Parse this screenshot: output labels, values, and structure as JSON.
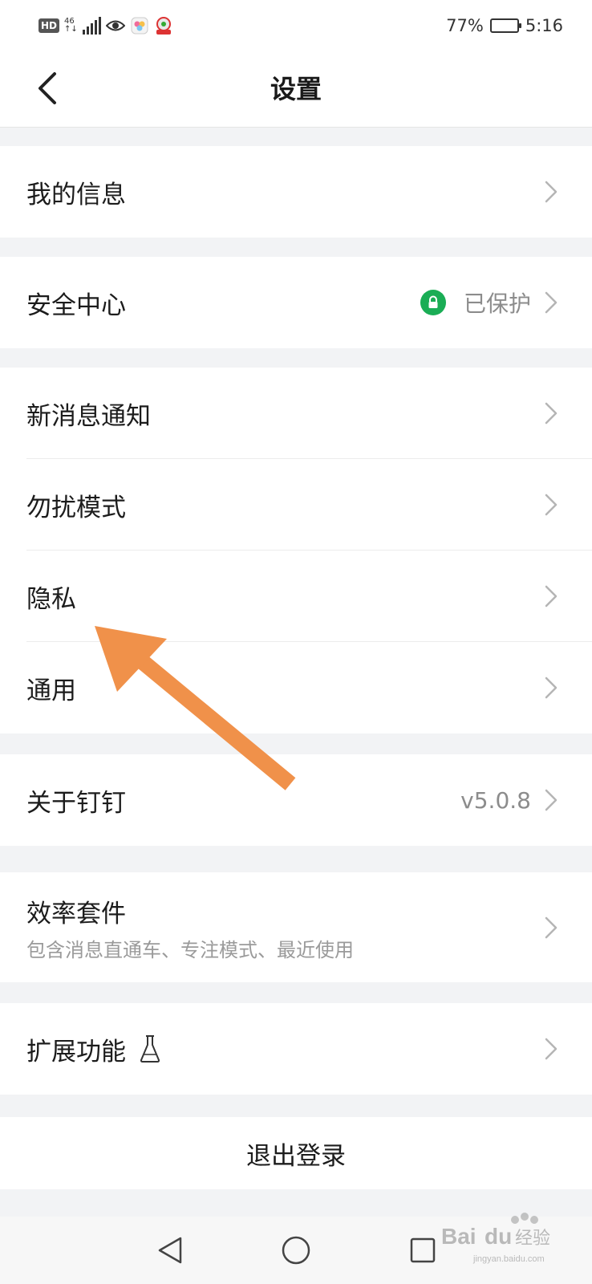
{
  "status_bar": {
    "hd": "HD",
    "network_top": "46",
    "network_bottom": "↑↓",
    "battery_percent": "77%",
    "battery_level": 0.77,
    "time": "5:16"
  },
  "header": {
    "title": "设置",
    "back_icon": "chevron-left-icon"
  },
  "sections": [
    {
      "items": [
        {
          "label": "我的信息"
        }
      ]
    },
    {
      "items": [
        {
          "label": "安全中心",
          "value": "已保护",
          "badge_icon": "lock-icon",
          "badge_color": "#1aad55"
        }
      ]
    },
    {
      "items": [
        {
          "label": "新消息通知"
        },
        {
          "label": "勿扰模式"
        },
        {
          "label": "隐私"
        },
        {
          "label": "通用"
        }
      ]
    },
    {
      "items": [
        {
          "label": "关于钉钉",
          "value": "v5.0.8"
        }
      ]
    },
    {
      "items": [
        {
          "label": "效率套件",
          "subtitle": "包含消息直通车、专注模式、最近使用"
        }
      ]
    },
    {
      "items": [
        {
          "label": "扩展功能",
          "label_icon": "flask-icon"
        }
      ]
    }
  ],
  "logout": {
    "label": "退出登录"
  },
  "nav": {
    "back_icon": "triangle-back-icon",
    "home_icon": "circle-home-icon",
    "recents_icon": "square-recents-icon"
  },
  "annotation": {
    "arrow_color": "#f0914a",
    "points_to": "隐私"
  },
  "watermark": {
    "brand": "Bai",
    "brand2": "du",
    "suffix": "经验",
    "url": "jingyan.baidu.com"
  }
}
